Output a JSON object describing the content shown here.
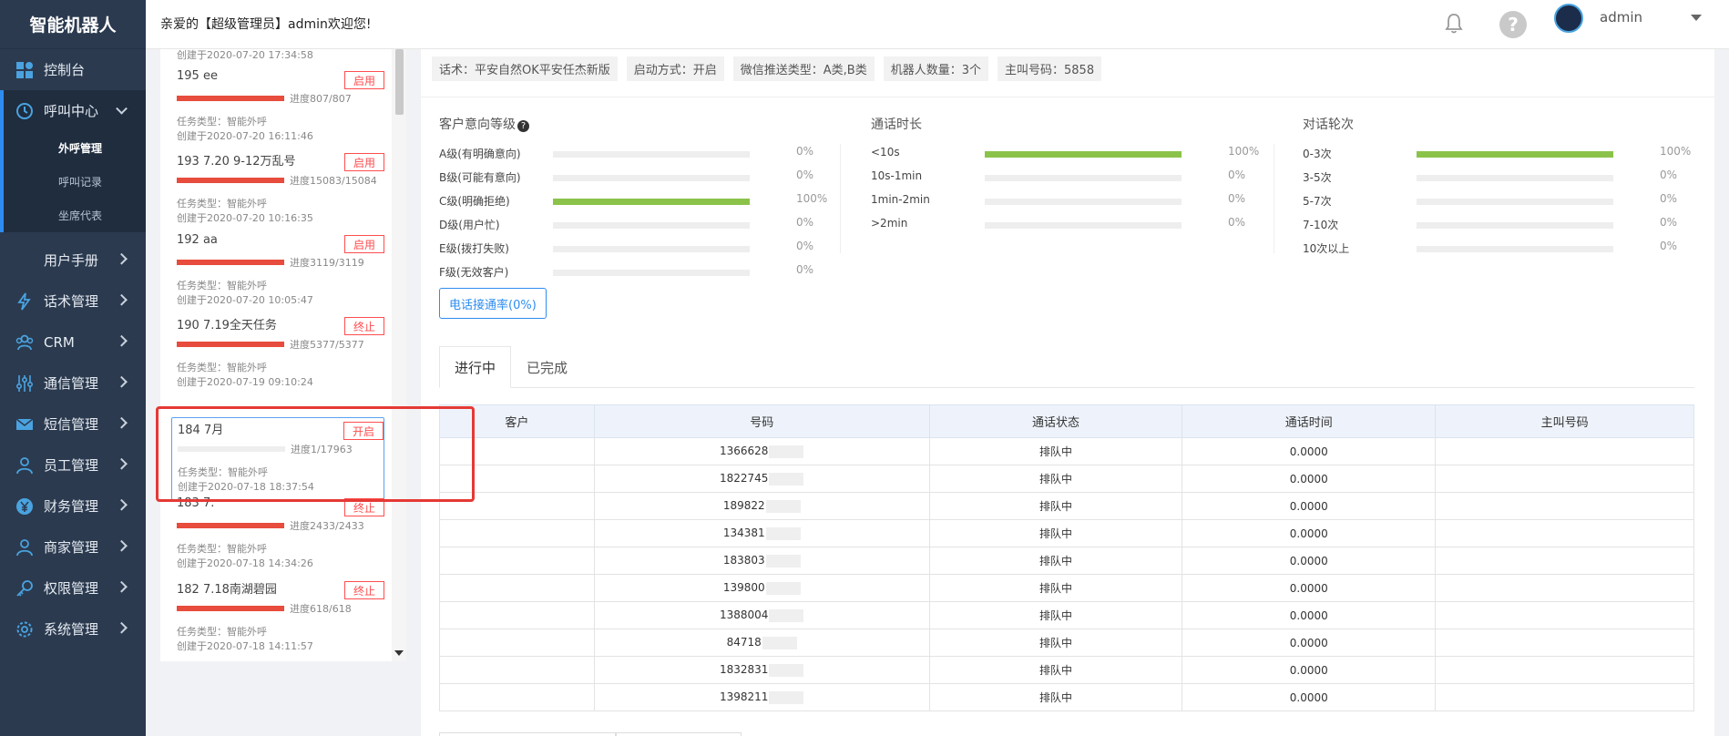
{
  "app": {
    "logo": "智能机器人",
    "welcome": "亲爱的【超级管理员】admin欢迎您!",
    "user_name": "admin"
  },
  "sidebar": {
    "items": [
      {
        "label": "控制台",
        "icon": "dashboard-icon"
      },
      {
        "label": "呼叫中心",
        "icon": "clock-icon"
      },
      {
        "label": "用户手册",
        "icon": ""
      },
      {
        "label": "话术管理",
        "icon": "lightning-icon"
      },
      {
        "label": "CRM",
        "icon": "users-icon"
      },
      {
        "label": "通信管理",
        "icon": "sliders-icon"
      },
      {
        "label": "短信管理",
        "icon": "mail-icon"
      },
      {
        "label": "员工管理",
        "icon": "person-icon"
      },
      {
        "label": "财务管理",
        "icon": "yen-icon"
      },
      {
        "label": "商家管理",
        "icon": "person-icon"
      },
      {
        "label": "权限管理",
        "icon": "key-icon"
      },
      {
        "label": "系统管理",
        "icon": "gear-icon"
      }
    ],
    "sub_items": [
      "外呼管理",
      "呼叫记录",
      "坐席代表"
    ]
  },
  "tasks": {
    "top_created": "创建于2020-07-20 17:34:58",
    "type_label": "任务类型：智能外呼",
    "list": [
      {
        "title": "195  ee",
        "button": "启用",
        "progress_text": "进度807/807",
        "progress": 1.0,
        "created": "创建于2020-07-20 16:11:46"
      },
      {
        "title": "193  7.20 9-12万乱号",
        "button": "启用",
        "progress_text": "进度15083/15084",
        "progress": 1.0,
        "created": "创建于2020-07-20 10:16:35"
      },
      {
        "title": "192  aa",
        "button": "启用",
        "progress_text": "进度3119/3119",
        "progress": 1.0,
        "created": "创建于2020-07-20 10:05:47"
      },
      {
        "title": "190  7.19全天任务",
        "button": "终止",
        "progress_text": "进度5377/5377",
        "progress": 1.0,
        "created": "创建于2020-07-19 09:10:24"
      },
      {
        "title": "184 7月",
        "button": "开启",
        "progress_text": "进度1/17963",
        "progress": 0.0,
        "created": "创建于2020-07-18 18:37:54"
      },
      {
        "title": "183  7.",
        "button": "终止",
        "progress_text": "进度2433/2433",
        "progress": 1.0,
        "created": "创建于2020-07-18 14:34:26"
      },
      {
        "title": "182  7.18南湖碧园",
        "button": "终止",
        "progress_text": "进度618/618",
        "progress": 1.0,
        "created": "创建于2020-07-18 14:11:57"
      }
    ]
  },
  "info_tags": [
    "话术：平安自然OK平安任杰新版",
    "启动方式：开启",
    "微信推送类型：A类,B类",
    "机器人数量：3个",
    "主叫号码：5858"
  ],
  "stats": {
    "intent": {
      "title": "客户意向等级",
      "rows": [
        {
          "label": "A级(有明确意向)",
          "pct": "0%",
          "value": 0
        },
        {
          "label": "B级(可能有意向)",
          "pct": "0%",
          "value": 0
        },
        {
          "label": "C级(明确拒绝)",
          "pct": "100%",
          "value": 100
        },
        {
          "label": "D级(用户忙)",
          "pct": "0%",
          "value": 0
        },
        {
          "label": "E级(拨打失败)",
          "pct": "0%",
          "value": 0
        },
        {
          "label": "F级(无效客户)",
          "pct": "0%",
          "value": 0
        }
      ]
    },
    "duration": {
      "title": "通话时长",
      "rows": [
        {
          "label": "<10s",
          "pct": "100%",
          "value": 100
        },
        {
          "label": "10s-1min",
          "pct": "0%",
          "value": 0
        },
        {
          "label": "1min-2min",
          "pct": "0%",
          "value": 0
        },
        {
          "label": ">2min",
          "pct": "0%",
          "value": 0
        }
      ]
    },
    "rounds": {
      "title": "对话轮次",
      "rows": [
        {
          "label": "0-3次",
          "pct": "100%",
          "value": 100
        },
        {
          "label": "3-5次",
          "pct": "0%",
          "value": 0
        },
        {
          "label": "5-7次",
          "pct": "0%",
          "value": 0
        },
        {
          "label": "7-10次",
          "pct": "0%",
          "value": 0
        },
        {
          "label": "10次以上",
          "pct": "0%",
          "value": 0
        }
      ]
    }
  },
  "connect_rate_button": "电话接通率(0%)",
  "tabs": [
    "进行中",
    "已完成"
  ],
  "table": {
    "headers": [
      "客户",
      "号码",
      "通话状态",
      "通话时间",
      "主叫号码"
    ],
    "rows": [
      {
        "customer": "",
        "number": "1366628",
        "status": "排队中",
        "time": "0.0000",
        "caller": ""
      },
      {
        "customer": "",
        "number": "1822745",
        "status": "排队中",
        "time": "0.0000",
        "caller": ""
      },
      {
        "customer": "",
        "number": "189822",
        "status": "排队中",
        "time": "0.0000",
        "caller": ""
      },
      {
        "customer": "",
        "number": "134381",
        "status": "排队中",
        "time": "0.0000",
        "caller": ""
      },
      {
        "customer": "",
        "number": "183803",
        "status": "排队中",
        "time": "0.0000",
        "caller": ""
      },
      {
        "customer": "",
        "number": "139800",
        "status": "排队中",
        "time": "0.0000",
        "caller": ""
      },
      {
        "customer": "",
        "number": "1388004",
        "status": "排队中",
        "time": "0.0000",
        "caller": ""
      },
      {
        "customer": "",
        "number": "84718",
        "status": "排队中",
        "time": "0.0000",
        "caller": ""
      },
      {
        "customer": "",
        "number": "1832831",
        "status": "排队中",
        "time": "0.0000",
        "caller": ""
      },
      {
        "customer": "",
        "number": "1398211",
        "status": "排队中",
        "time": "0.0000",
        "caller": ""
      }
    ]
  },
  "colors": {
    "sidebar_bg": "#2b3a4f",
    "accent": "#2d8cf0",
    "danger": "#ff4d4f",
    "bar_green": "#8bc34a",
    "progress_red": "#e74c3c"
  }
}
